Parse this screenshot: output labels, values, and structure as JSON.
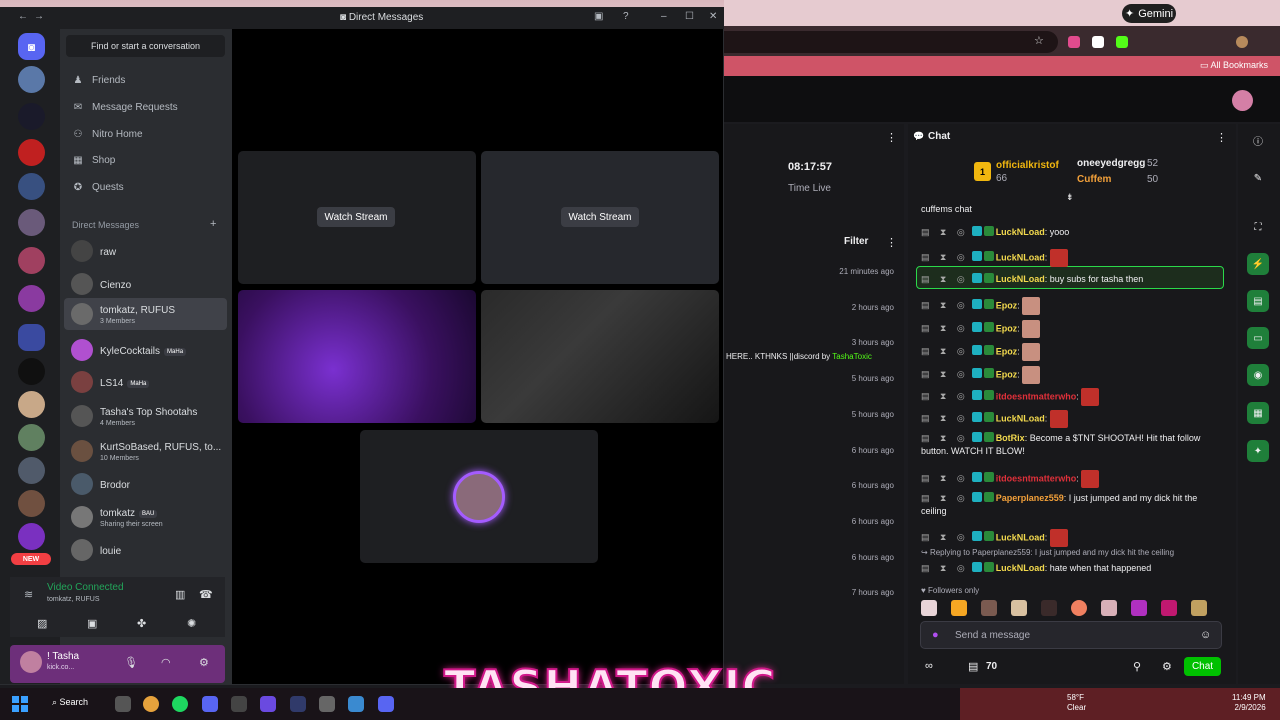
{
  "browser": {
    "gemini_label": "Gemini",
    "all_bookmarks": "All Bookmarks"
  },
  "discord": {
    "window_title": "Direct Messages",
    "find_convo": "Find or start a conversation",
    "nav": [
      {
        "label": "Friends",
        "icon": "friends-icon"
      },
      {
        "label": "Message Requests",
        "icon": "mail-icon"
      },
      {
        "label": "Nitro Home",
        "icon": "nitro-icon"
      },
      {
        "label": "Shop",
        "icon": "shop-icon"
      },
      {
        "label": "Quests",
        "icon": "quests-icon"
      }
    ],
    "dm_header": "Direct Messages",
    "dms": [
      {
        "name": "raw",
        "sub": "",
        "tag": "",
        "color": "#444"
      },
      {
        "name": "Cienzo",
        "sub": "",
        "tag": "",
        "color": "#555"
      },
      {
        "name": "tomkatz, RUFUS",
        "sub": "3 Members",
        "tag": "",
        "color": "#6a6a6a"
      },
      {
        "name": "KyleCocktails",
        "sub": "",
        "tag": "MaHa",
        "color": "#b050d0"
      },
      {
        "name": "LS14",
        "sub": "",
        "tag": "MaHa",
        "color": "#7a4040"
      },
      {
        "name": "Tasha's Top Shootahs",
        "sub": "4 Members",
        "tag": "",
        "color": "#555"
      },
      {
        "name": "KurtSoBased, RUFUS, to...",
        "sub": "10 Members",
        "tag": "",
        "color": "#6a5040"
      },
      {
        "name": "Brodor",
        "sub": "",
        "tag": "",
        "color": "#4a5a6a"
      },
      {
        "name": "tomkatz",
        "sub": "Sharing their screen",
        "tag": "BAU",
        "color": "#777"
      },
      {
        "name": "louie",
        "sub": "",
        "tag": "",
        "color": "#666"
      }
    ],
    "voice": {
      "status": "Video Connected",
      "channel": "tomkatz, RUFUS"
    },
    "user": {
      "name": "! Tasha",
      "status": "kick.co..."
    },
    "new_badge": "NEW",
    "stream": {
      "watch_label": "Watch Stream"
    }
  },
  "twitch": {
    "stream_time": "08:17:57",
    "time_live_label": "Time Live",
    "filter_label": "Filter",
    "activity_times": [
      "21 minutes ago",
      "2 hours ago",
      "3 hours ago",
      "5 hours ago",
      "5 hours ago",
      "6 hours ago",
      "6 hours ago",
      "6 hours ago",
      "6 hours ago",
      "7 hours ago"
    ],
    "notice": {
      "text": "HERE.. KTHNKS ||discord by ",
      "user": "TashaToxic"
    },
    "chat": {
      "title": "Chat",
      "leaderboard": {
        "rank": "1",
        "first": {
          "name": "officialkristof",
          "count": "66"
        },
        "second": {
          "name": "oneeyedgregg",
          "count": "52"
        },
        "third": {
          "name": "Cuffem",
          "count": "50"
        }
      },
      "room": "cuffems chat",
      "messages": [
        {
          "user": "LuckNLoad",
          "text": "yooo",
          "color": "#f2d94e"
        },
        {
          "user": "LuckNLoad",
          "text": "",
          "color": "#f2d94e"
        },
        {
          "user": "LuckNLoad",
          "text": "buy subs for tasha then",
          "color": "#f2d94e"
        },
        {
          "user": "Epoz",
          "text": "",
          "color": "#f2d94e"
        },
        {
          "user": "Epoz",
          "text": "",
          "color": "#f2d94e"
        },
        {
          "user": "Epoz",
          "text": "",
          "color": "#f2d94e"
        },
        {
          "user": "Epoz",
          "text": "",
          "color": "#f2d94e"
        },
        {
          "user": "itdoesntmatterwho",
          "text": "",
          "color": "#e0303a"
        },
        {
          "user": "LuckNLoad",
          "text": "",
          "color": "#f2d94e"
        },
        {
          "user": "BotRix",
          "text": "Become a $TNT SHOOTAH! Hit that follow button. WATCH IT BLOW!",
          "color": "#f2d94e"
        },
        {
          "user": "itdoesntmatterwho",
          "text": "",
          "color": "#e0303a"
        },
        {
          "user": "Paperplanez559",
          "text": "I just jumped and my dick hit the ceiling",
          "color": "#f2a03a"
        },
        {
          "user": "LuckNLoad",
          "text": "",
          "color": "#f2d94e"
        },
        {
          "user": "LuckNLoad",
          "text": "hate when that happened",
          "color": "#f2d94e"
        }
      ],
      "reply_to": "Replying to Paperplanez559: I just jumped and my dick hit the ceiling",
      "followers_only": "Followers only",
      "input_placeholder": "Send a message",
      "points": "70",
      "send_label": "Chat"
    }
  },
  "overlay": {
    "banner": "TASHATOXIC"
  },
  "taskbar": {
    "search": "Search",
    "temp": "58°F",
    "weather": "Clear",
    "time": "11:49 PM",
    "date": "2/9/2026"
  }
}
